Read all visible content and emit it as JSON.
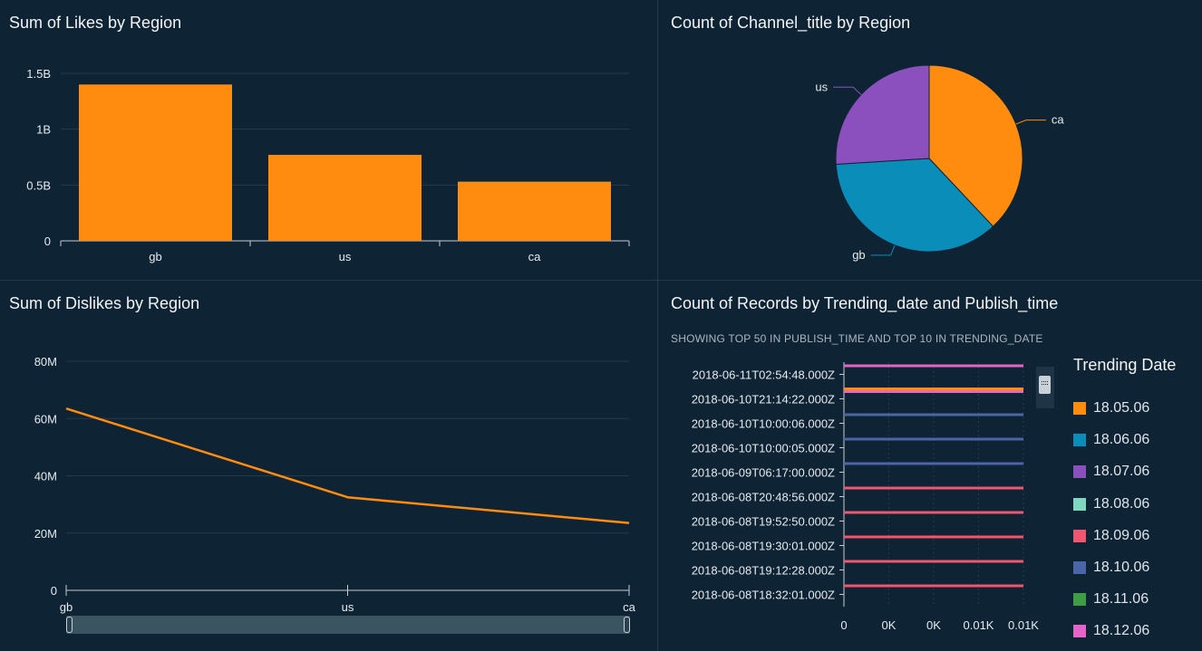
{
  "colors": {
    "background": "#0e2333",
    "orange": "#ff8c0f",
    "grid": "#273a4b",
    "axis": "#c4ccd3",
    "tick_text": "#e6ebef"
  },
  "panels": {
    "likes": {
      "title": "Sum of Likes by Region"
    },
    "channels": {
      "title": "Count of Channel_title by Region"
    },
    "dislikes": {
      "title": "Sum of Dislikes by Region"
    },
    "records": {
      "title": "Count of Records by Trending_date and Publish_time",
      "subtitle": "SHOWING TOP 50 IN PUBLISH_TIME AND TOP 10 IN TRENDING_DATE"
    }
  },
  "chart_data": [
    {
      "type": "bar",
      "title": "Sum of Likes by Region",
      "categories": [
        "gb",
        "us",
        "ca"
      ],
      "values": [
        1400000000,
        770000000,
        530000000
      ],
      "ylim": [
        0,
        1500000000
      ],
      "ytick_values": [
        0,
        500000000,
        1000000000,
        1500000000
      ],
      "ytick_labels": [
        "0",
        "0.5B",
        "1B",
        "1.5B"
      ],
      "grid": true,
      "color": "#ff8c0f"
    },
    {
      "type": "pie",
      "title": "Count of Channel_title by Region",
      "labels": [
        "ca",
        "gb",
        "us"
      ],
      "values": [
        38,
        36,
        26
      ],
      "colors": [
        "#ff8c0f",
        "#0b8dba",
        "#8c50be"
      ]
    },
    {
      "type": "line",
      "title": "Sum of Dislikes by Region",
      "categories": [
        "gb",
        "us",
        "ca"
      ],
      "values": [
        63500000,
        32500000,
        23500000
      ],
      "ylim": [
        0,
        80000000
      ],
      "ytick_values": [
        0,
        20000000,
        40000000,
        60000000,
        80000000
      ],
      "ytick_labels": [
        "0",
        "20M",
        "40M",
        "60M",
        "80M"
      ],
      "grid": true,
      "color": "#ff8c0f"
    },
    {
      "type": "bar",
      "title": "Count of Records by Trending_date and Publish_time",
      "orientation": "horizontal",
      "categories": [
        "2018-06-11T02:54:48.000Z",
        "2018-06-10T21:14:22.000Z",
        "2018-06-10T10:00:06.000Z",
        "2018-06-10T10:00:05.000Z",
        "2018-06-09T06:17:00.000Z",
        "2018-06-08T20:48:56.000Z",
        "2018-06-08T19:52:50.000Z",
        "2018-06-08T19:30:01.000Z",
        "2018-06-08T19:12:28.000Z",
        "2018-06-08T18:32:01.000Z"
      ],
      "xtick_labels": [
        "0",
        "0K",
        "0K",
        "0.01K",
        "0.01K"
      ],
      "xlim": [
        0,
        8
      ],
      "xtick_values": [
        0,
        2,
        4,
        6,
        8
      ],
      "series": [
        {
          "name": "18.05.06",
          "color": "#ff8c0f",
          "values": [
            0,
            8,
            0,
            0,
            0,
            0,
            0,
            0,
            0,
            0
          ]
        },
        {
          "name": "18.06.06",
          "color": "#0b8dba",
          "values": [
            0,
            0,
            0,
            0,
            0,
            0,
            0,
            0,
            0,
            0
          ]
        },
        {
          "name": "18.07.06",
          "color": "#8c50be",
          "values": [
            0,
            0,
            0,
            0,
            0,
            0,
            0,
            0,
            0,
            0
          ]
        },
        {
          "name": "18.08.06",
          "color": "#7fd8be",
          "values": [
            0,
            0,
            0,
            0,
            0,
            0,
            0,
            0,
            0,
            0
          ]
        },
        {
          "name": "18.09.06",
          "color": "#f0566f",
          "values": [
            0,
            0,
            0,
            0,
            0,
            8,
            8,
            8,
            8,
            8
          ]
        },
        {
          "name": "18.10.06",
          "color": "#4a66a8",
          "values": [
            0,
            0,
            8,
            8,
            8,
            0,
            0,
            0,
            0,
            0
          ]
        },
        {
          "name": "18.11.06",
          "color": "#3f9e45",
          "values": [
            0,
            0,
            0,
            0,
            0,
            0,
            0,
            0,
            0,
            0
          ]
        },
        {
          "name": "18.12.06",
          "color": "#e464c8",
          "values": [
            8,
            8,
            0,
            0,
            0,
            0,
            0,
            0,
            0,
            0
          ]
        }
      ],
      "legend": {
        "title": "Trending Date",
        "position": "right"
      }
    }
  ]
}
